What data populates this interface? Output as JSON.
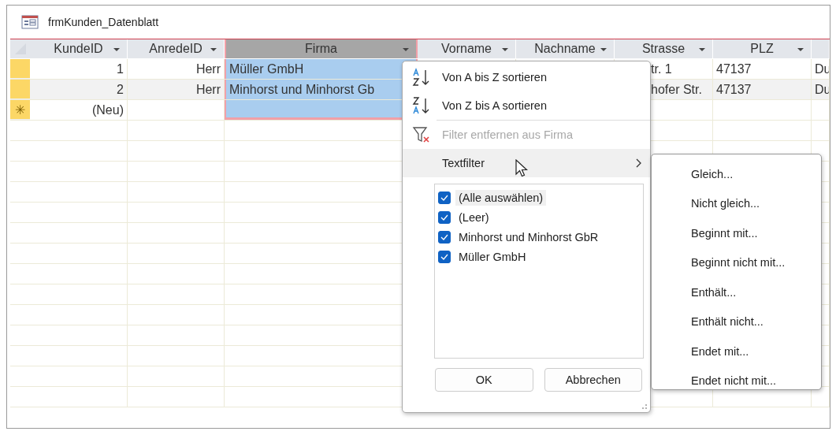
{
  "window": {
    "title": "frmKunden_Datenblatt"
  },
  "table": {
    "columns": [
      {
        "label": "KundeID",
        "selected": false
      },
      {
        "label": "AnredeID",
        "selected": false
      },
      {
        "label": "Firma",
        "selected": true
      },
      {
        "label": "Vorname",
        "selected": false
      },
      {
        "label": "Nachname",
        "selected": false
      },
      {
        "label": "Strasse",
        "selected": false
      },
      {
        "label": "PLZ",
        "selected": false
      }
    ],
    "rows": [
      {
        "marker": "",
        "cells": [
          "1",
          "Herr",
          "Müller GmbH",
          "",
          "",
          "tr. 1",
          "47137",
          "Du"
        ]
      },
      {
        "marker": "",
        "cells": [
          "2",
          "Herr",
          "Minhorst und Minhorst Gb",
          "",
          "",
          "hofer Str.",
          "47137",
          "Du"
        ]
      },
      {
        "marker": "✳",
        "cells": [
          "(Neu)",
          "",
          "",
          "",
          "",
          "",
          "",
          ""
        ]
      }
    ]
  },
  "filter_menu": {
    "items": [
      {
        "kind": "sort_asc",
        "label": "Von A bis Z sortieren",
        "disabled": false,
        "selected": false
      },
      {
        "kind": "sort_desc",
        "label": "Von Z bis A sortieren",
        "disabled": false,
        "selected": false
      },
      {
        "kind": "clear_filter",
        "label": "Filter entfernen aus Firma",
        "disabled": true,
        "selected": false
      },
      {
        "kind": "submenu",
        "label": "Textfilter",
        "disabled": false,
        "selected": true
      }
    ],
    "values": [
      {
        "label": "(Alle auswählen)",
        "checked": true,
        "selected": true
      },
      {
        "label": "(Leer)",
        "checked": true,
        "selected": false
      },
      {
        "label": "Minhorst und Minhorst GbR",
        "checked": true,
        "selected": false
      },
      {
        "label": "Müller GmbH",
        "checked": true,
        "selected": false
      }
    ],
    "buttons": [
      "OK",
      "Abbrechen"
    ]
  },
  "submenu": {
    "items": [
      "Gleich...",
      "Nicht gleich...",
      "Beginnt mit...",
      "Beginnt nicht mit...",
      "Enthält...",
      "Enthält nicht...",
      "Endet mit...",
      "Endet nicht mit..."
    ]
  }
}
